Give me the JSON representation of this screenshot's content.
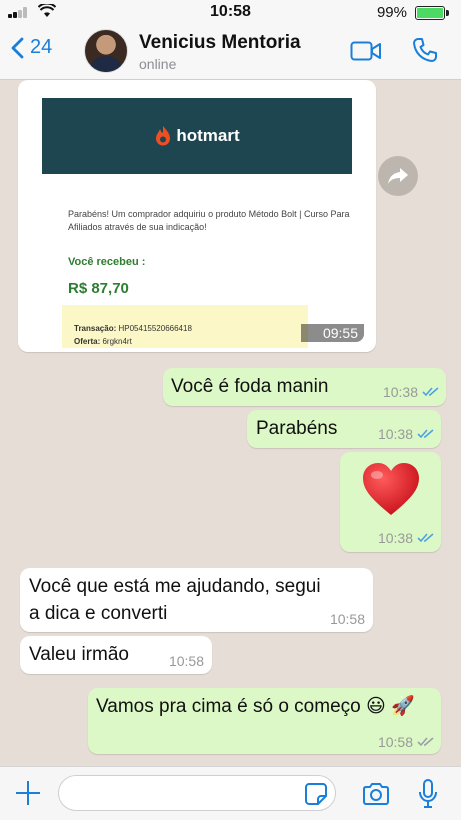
{
  "status_bar": {
    "time": "10:58",
    "battery": "99%"
  },
  "header": {
    "back_count": "24",
    "contact_name": "Venicius Mentoria",
    "contact_status": "online"
  },
  "image_message": {
    "brand": "hotmart",
    "body_text": "Parabéns! Um comprador adquiriu o produto Método Bolt | Curso Para Afiliados através de sua indicação!",
    "received_label": "Você recebeu :",
    "amount": "R$ 87,70",
    "transaction_label": "Transação:",
    "transaction_value": "HP05415520666418",
    "offer_label": "Oferta:",
    "offer_value": "6rgkn4rt",
    "time": "09:55"
  },
  "messages": [
    {
      "direction": "outgoing",
      "text": "Você é foda manin",
      "time": "10:38",
      "read": true
    },
    {
      "direction": "outgoing",
      "text": "Parabéns",
      "time": "10:38",
      "read": true
    },
    {
      "direction": "outgoing",
      "text": "❤️",
      "time": "10:38",
      "read": true,
      "emoji_name": "red-heart"
    },
    {
      "direction": "incoming",
      "text": "Você que está me ajudando, segui a dica e converti",
      "time": "10:58"
    },
    {
      "direction": "incoming",
      "text": "Valeu irmão",
      "time": "10:58"
    },
    {
      "direction": "outgoing",
      "text": "Vamos pra cima é só o começo 😃 🚀",
      "time": "10:58",
      "read": false
    }
  ],
  "input": {
    "placeholder": "",
    "value": ""
  },
  "colors": {
    "accent": "#1a7fd8",
    "outgoing_bubble": "#dcf8c6",
    "incoming_bubble": "#ffffff",
    "chat_background": "#e6ded6",
    "read_ticks": "#4fa3e0",
    "hotmart_header": "#1e4650",
    "hotmart_flame": "#ef4e23"
  },
  "icons": [
    "back-chevron-icon",
    "video-call-icon",
    "phone-icon",
    "forward-icon",
    "plus-icon",
    "sticker-icon",
    "camera-icon",
    "microphone-icon"
  ]
}
